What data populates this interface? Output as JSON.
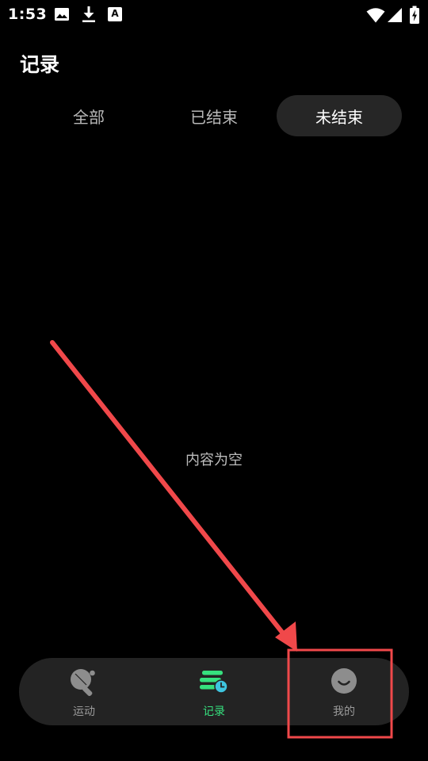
{
  "status_bar": {
    "time": "1:53",
    "left_icons": [
      "image-icon",
      "download-icon",
      "font-app-icon"
    ],
    "font_app_glyph": "A",
    "right_icons": [
      "wifi-icon",
      "cell-signal-icon",
      "battery-charging-icon"
    ]
  },
  "header": {
    "title": "记录"
  },
  "filter_tabs": [
    {
      "label": "全部",
      "selected": false
    },
    {
      "label": "已结束",
      "selected": false
    },
    {
      "label": "未结束",
      "selected": true
    }
  ],
  "content": {
    "empty_text": "内容为空"
  },
  "bottom_nav": [
    {
      "label": "运动",
      "icon": "ping-pong-paddle-icon",
      "active": false
    },
    {
      "label": "记录",
      "icon": "records-list-icon",
      "active": true
    },
    {
      "label": "我的",
      "icon": "smiley-profile-icon",
      "active": false
    }
  ],
  "colors": {
    "background": "#000000",
    "accent": "#36e07e",
    "record_clock": "#3ec5e0",
    "annotation": "#f0484a",
    "tabbar": "#232323",
    "segment_active": "#262626"
  }
}
